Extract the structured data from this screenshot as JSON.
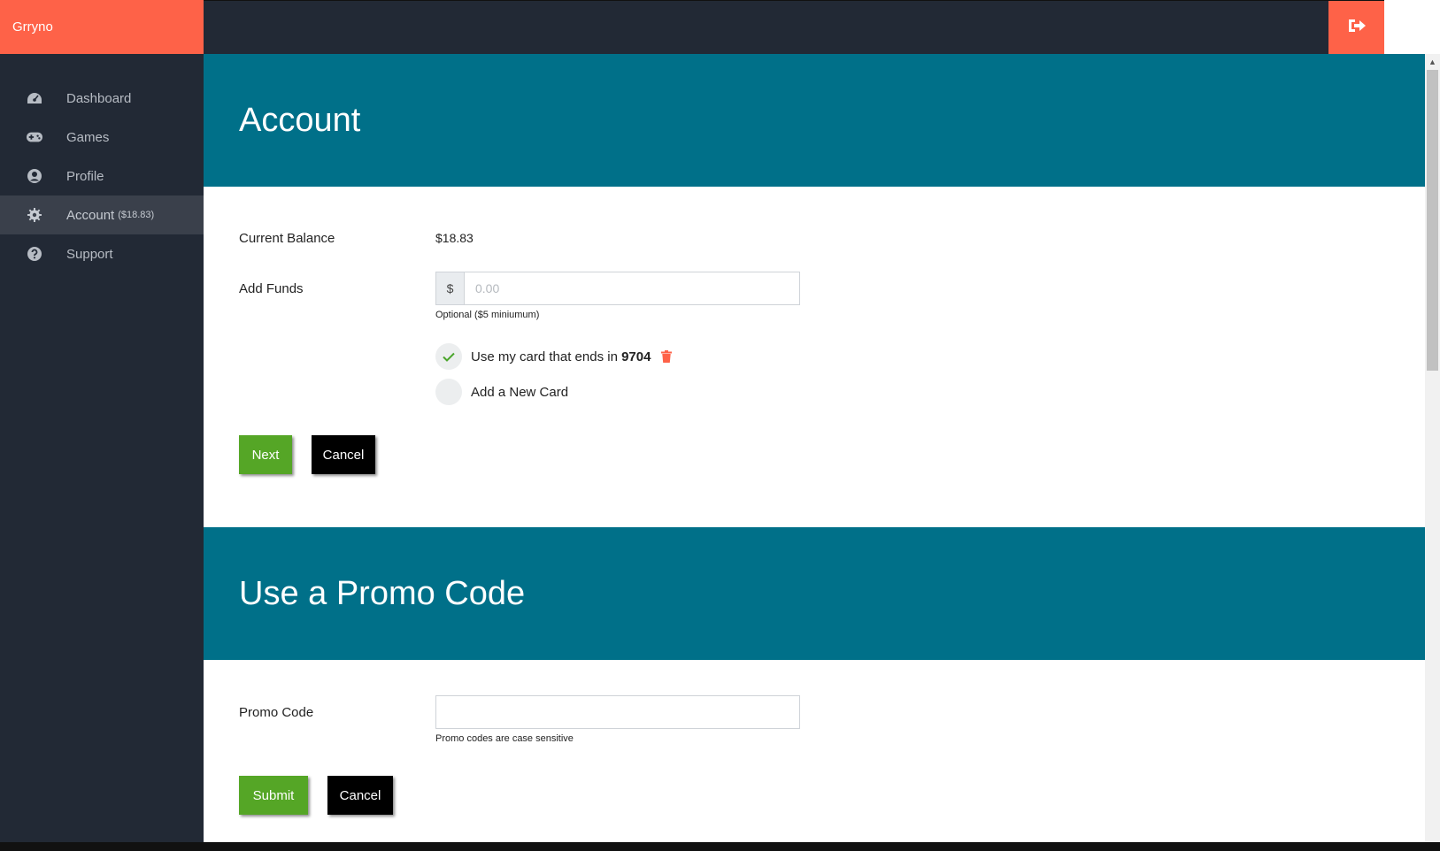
{
  "brand": {
    "name": "Grryno"
  },
  "colors": {
    "accent": "#fe6248",
    "header_band": "#007089",
    "sidebar_bg": "#222935",
    "success": "#55a626"
  },
  "topbar": {
    "logout_icon": "sign-out-icon"
  },
  "sidebar": {
    "items": [
      {
        "label": "Dashboard",
        "icon": "speedometer-icon"
      },
      {
        "label": "Games",
        "icon": "gamepad-icon"
      },
      {
        "label": "Profile",
        "icon": "user-circle-icon"
      },
      {
        "label": "Account",
        "extra": "($18.83)",
        "icon": "gear-icon",
        "active": true
      },
      {
        "label": "Support",
        "icon": "question-circle-icon"
      }
    ]
  },
  "account": {
    "title": "Account",
    "balance_label": "Current Balance",
    "balance_value": "$18.83",
    "add_funds_label": "Add Funds",
    "currency_symbol": "$",
    "amount_placeholder": "0.00",
    "amount_help": "Optional ($5 miniumum)",
    "card_option_text": "Use my card that ends in",
    "card_last4": "9704",
    "card_selected": true,
    "new_card_text": "Add a New Card",
    "next_label": "Next",
    "cancel_label": "Cancel"
  },
  "promo": {
    "title": "Use a Promo Code",
    "code_label": "Promo Code",
    "code_value": "",
    "code_help": "Promo codes are case sensitive",
    "submit_label": "Submit",
    "cancel_label": "Cancel"
  }
}
